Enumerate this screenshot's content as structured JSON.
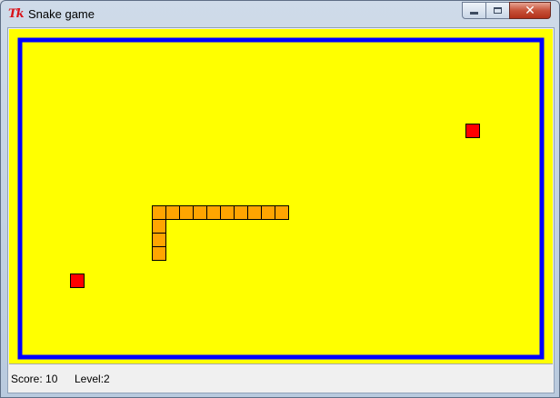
{
  "window": {
    "title": "Snake game",
    "icon": "tk-feather-icon",
    "icon_text": "Tk",
    "buttons": {
      "minimize": "minimize-icon",
      "maximize": "maximize-icon",
      "close": "close-icon"
    }
  },
  "board": {
    "background_color": "#ffff00",
    "wall_color": "#0000ff",
    "cell_size": 15,
    "cols": 39,
    "rows": 24,
    "snake": {
      "color": "#ffa500",
      "outline": "#000000",
      "segments": [
        [
          19,
          12
        ],
        [
          18,
          12
        ],
        [
          17,
          12
        ],
        [
          16,
          12
        ],
        [
          15,
          12
        ],
        [
          14,
          12
        ],
        [
          13,
          12
        ],
        [
          12,
          12
        ],
        [
          11,
          12
        ],
        [
          10,
          12
        ],
        [
          10,
          13
        ],
        [
          10,
          14
        ],
        [
          10,
          15
        ]
      ]
    },
    "food": {
      "color": "#ff0000",
      "items": [
        [
          33,
          6
        ],
        [
          4,
          17
        ]
      ]
    }
  },
  "status": {
    "score": "Score: 10",
    "level": "Level:2"
  }
}
